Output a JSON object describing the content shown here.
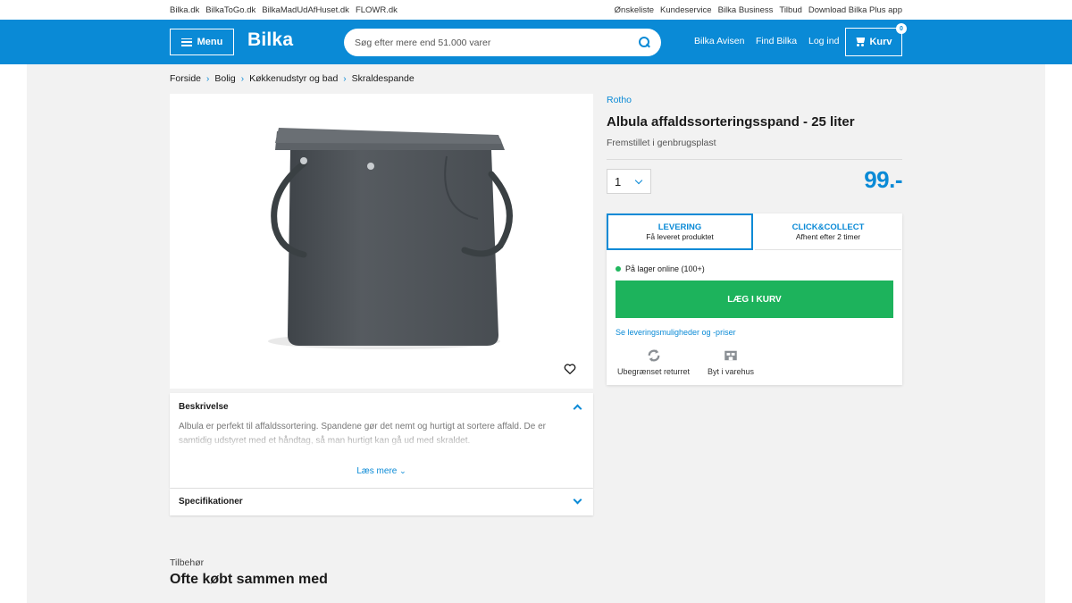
{
  "topbar": {
    "left_links": [
      "Bilka.dk",
      "BilkaToGo.dk",
      "BilkaMadUdAfHuset.dk",
      "FLOWR.dk"
    ],
    "right_links": [
      "Ønskeliste",
      "Kundeservice",
      "Bilka Business",
      "Tilbud",
      "Download Bilka Plus app"
    ]
  },
  "header": {
    "menu_label": "Menu",
    "logo_text": "Bilka",
    "search_placeholder": "Søg efter mere end 51.000 varer",
    "links": [
      "Bilka Avisen",
      "Find Bilka",
      "Log ind"
    ],
    "cart_label": "Kurv",
    "cart_count": "0"
  },
  "breadcrumb": [
    "Forside",
    "Bolig",
    "Køkkenudstyr og bad",
    "Skraldespande"
  ],
  "description": {
    "title": "Beskrivelse",
    "text": "Albula er perfekt til affaldssortering. Spandene gør det nemt og hurtigt at sortere affald. De er samtidig udstyret med et håndtag, så man hurtigt kan gå ud med skraldet.",
    "read_more": "Læs mere"
  },
  "specifications": {
    "title": "Specifikationer"
  },
  "accessories": {
    "label": "Tilbehør",
    "title": "Ofte købt sammen med"
  },
  "product": {
    "brand": "Rotho",
    "title": "Albula affaldssorteringsspand - 25 liter",
    "subtitle": "Fremstillet i genbrugsplast",
    "quantity": "1",
    "price": "99.-"
  },
  "delivery": {
    "tab_delivery_title": "LEVERING",
    "tab_delivery_sub": "Få leveret produktet",
    "tab_cc_title": "CLICK&COLLECT",
    "tab_cc_sub": "Afhent efter 2 timer",
    "stock": "På lager online (100+)",
    "add_to_cart": "LÆG I KURV",
    "delivery_link": "Se leveringsmuligheder og -priser",
    "feature_return": "Ubegrænset returret",
    "feature_exchange": "Byt i varehus"
  },
  "colors": {
    "brand_blue": "#0a8ad6",
    "cta_green": "#1db35c",
    "bin_grey": "#4f5459"
  }
}
